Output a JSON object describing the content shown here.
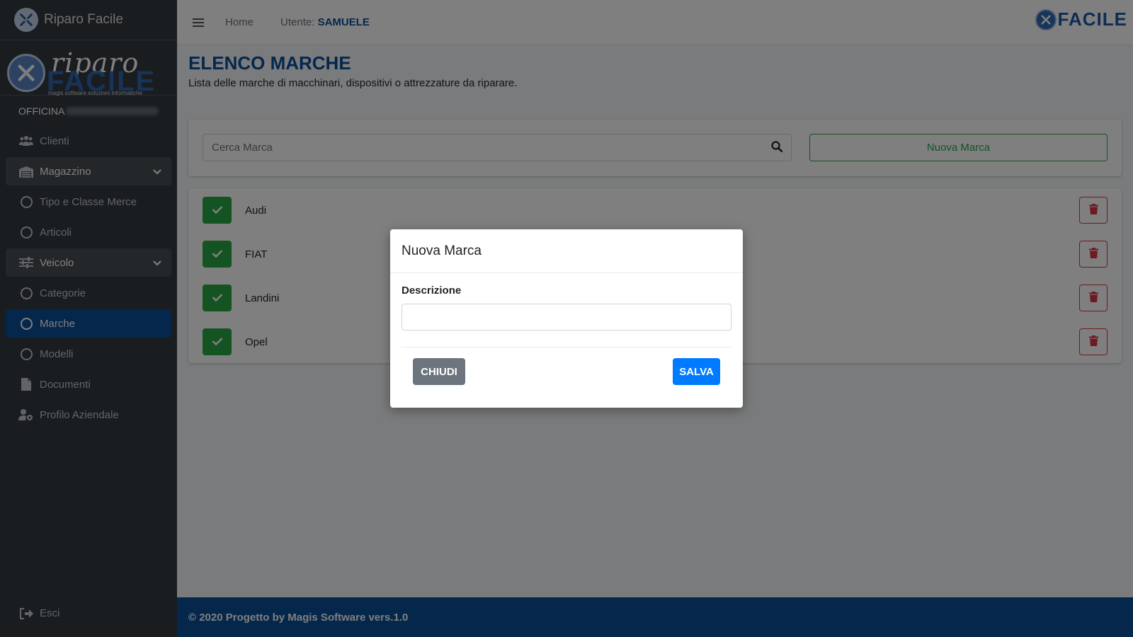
{
  "app": {
    "brand_name": "Riparo Facile",
    "logo_script": "riparo",
    "logo_word": "FACILE",
    "logo_tagline": "magis software soluzioni informatiche",
    "officina_label": "OFFICINA"
  },
  "sidebar": {
    "items": [
      {
        "label": "Clienti",
        "icon": "users-icon"
      },
      {
        "label": "Magazzino",
        "icon": "warehouse-icon",
        "expandable": true
      },
      {
        "label": "Tipo e Classe Merce",
        "icon": "circle-icon"
      },
      {
        "label": "Articoli",
        "icon": "circle-icon"
      },
      {
        "label": "Veicolo",
        "icon": "sliders-icon",
        "expandable": true
      },
      {
        "label": "Categorie",
        "icon": "circle-icon"
      },
      {
        "label": "Marche",
        "icon": "circle-icon",
        "active": true
      },
      {
        "label": "Modelli",
        "icon": "circle-icon"
      },
      {
        "label": "Documenti",
        "icon": "file-icon"
      },
      {
        "label": "Profilo Aziendale",
        "icon": "user-cog-icon"
      }
    ],
    "logout_label": "Esci"
  },
  "topbar": {
    "home_label": "Home",
    "user_prefix": "Utente:",
    "user_name": "SAMUELE",
    "logo_word": "FACILE"
  },
  "page": {
    "title": "ELENCO MARCHE",
    "subtitle": "Lista delle marche di macchinari, dispositivi o attrezzature da riparare."
  },
  "search": {
    "placeholder": "Cerca Marca",
    "new_button_label": "Nuova Marca"
  },
  "brands": [
    {
      "name": "Audi"
    },
    {
      "name": "FIAT"
    },
    {
      "name": "Landini"
    },
    {
      "name": "Opel"
    }
  ],
  "footer": {
    "text": "© 2020 Progetto by Magis Software vers.1.0"
  },
  "modal": {
    "title": "Nuova Marca",
    "field_label": "Descrizione",
    "field_value": "",
    "close_label": "CHIUDI",
    "save_label": "SALVA"
  },
  "colors": {
    "primary": "#0b4f99",
    "success": "#28a745",
    "danger": "#dc3545",
    "sidebar_bg": "#343a40",
    "save_button": "#007bff"
  }
}
